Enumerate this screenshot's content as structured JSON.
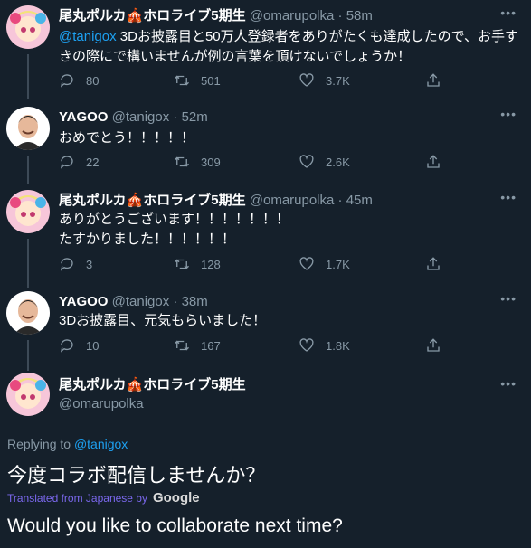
{
  "tweets": [
    {
      "name": "尾丸ポルカ🎪ホロライブ5期生",
      "handle": "@omarupolka",
      "sep": "·",
      "time": "58m",
      "mention": "@tanigox",
      "text": " 3Dお披露目と50万人登録者をありがたくも達成したので、お手すきの際にで構いませんが例の言葉を頂けないでしょうか！",
      "replies": "80",
      "retweets": "501",
      "likes": "3.7K"
    },
    {
      "name": "YAGOO",
      "handle": "@tanigox",
      "sep": "·",
      "time": "52m",
      "text": "おめでとう！！！！！",
      "replies": "22",
      "retweets": "309",
      "likes": "2.6K"
    },
    {
      "name": "尾丸ポルカ🎪ホロライブ5期生",
      "handle": "@omarupolka",
      "sep": "·",
      "time": "45m",
      "text_line1": "ありがとうございます！！！！！！！",
      "text_line2": "たすかりました！！！！！！",
      "replies": "3",
      "retweets": "128",
      "likes": "1.7K"
    },
    {
      "name": "YAGOO",
      "handle": "@tanigox",
      "sep": "·",
      "time": "38m",
      "text": "3Dお披露目、元気もらいました！",
      "replies": "10",
      "retweets": "167",
      "likes": "1.8K"
    }
  ],
  "main_tweet": {
    "name": "尾丸ポルカ🎪ホロライブ5期生",
    "handle": "@omarupolka",
    "replying_prefix": "Replying to ",
    "replying_to": "@tanigox",
    "text": "今度コラボ配信しませんか？",
    "translated_from": "Translated from Japanese by",
    "translator": "Google",
    "translation": "Would you like to collaborate next time?"
  },
  "more_label": "•••",
  "icons": [
    "reply-icon",
    "retweet-icon",
    "like-icon",
    "share-icon",
    "more-icon"
  ],
  "colors": {
    "background": "#15202b",
    "accent": "#1da1f2",
    "muted": "#8899a6",
    "translate": "#7b68ee"
  }
}
